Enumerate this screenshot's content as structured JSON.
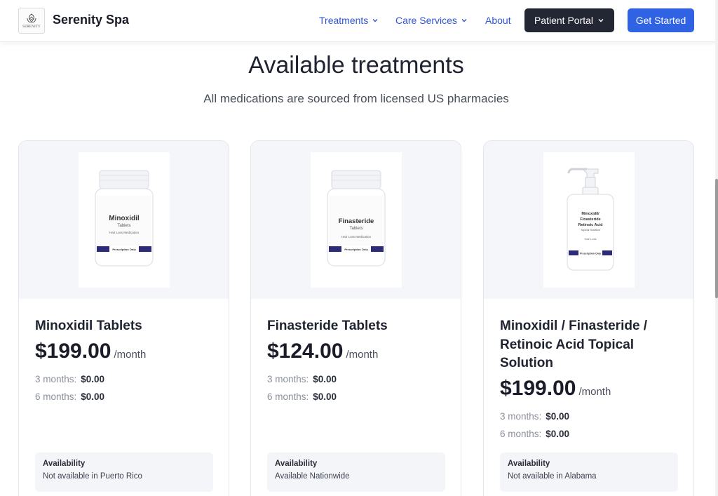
{
  "header": {
    "brand": "Serenity Spa",
    "logo_text": "SERENITY",
    "nav": {
      "treatments": "Treatments",
      "care_services": "Care Services",
      "about": "About"
    },
    "patient_portal": "Patient Portal",
    "get_started": "Get Started"
  },
  "section": {
    "title": "Available treatments",
    "subtitle": "All medications are sourced from licensed US pharmacies"
  },
  "products": [
    {
      "name": "Minoxidil Tablets",
      "price": "$199.00",
      "per": "/month",
      "plans": [
        {
          "label": "3 months:",
          "price": "$0.00"
        },
        {
          "label": "6 months:",
          "price": "$0.00"
        }
      ],
      "availability_label": "Availability",
      "availability": "Not available in Puerto Rico",
      "image": {
        "type": "bottle",
        "brand_text": "Minoxidil",
        "form_text": "Tablets",
        "purpose": "Hair Loss Medication",
        "stripe": "Prescription Only"
      }
    },
    {
      "name": "Finasteride Tablets",
      "price": "$124.00",
      "per": "/month",
      "plans": [
        {
          "label": "3 months:",
          "price": "$0.00"
        },
        {
          "label": "6 months:",
          "price": "$0.00"
        }
      ],
      "availability_label": "Availability",
      "availability": "Available Nationwide",
      "image": {
        "type": "bottle",
        "brand_text": "Finasteride",
        "form_text": "Tablets",
        "purpose": "Hair Loss Medication",
        "stripe": "Prescription Only"
      }
    },
    {
      "name": "Minoxidil / Finasteride / Retinoic Acid Topical Solution",
      "price": "$199.00",
      "per": "/month",
      "plans": [
        {
          "label": "3 months:",
          "price": "$0.00"
        },
        {
          "label": "6 months:",
          "price": "$0.00"
        }
      ],
      "availability_label": "Availability",
      "availability": "Not available in Alabama",
      "image": {
        "type": "pump",
        "line1": "Minoxidil/",
        "line2": "Finasteride",
        "line3": "Retinoic Acid",
        "form_text": "Topical Solution",
        "purpose": "Hair Loss",
        "stripe": "Prescription Only"
      }
    }
  ],
  "colors": {
    "accent": "#2f63e4",
    "nav_link": "#2f55d4",
    "dark_button": "#232733",
    "label_stripe": "#2e2a7a"
  },
  "icons": [
    "chevron-down-icon",
    "spa-logo-icon"
  ]
}
